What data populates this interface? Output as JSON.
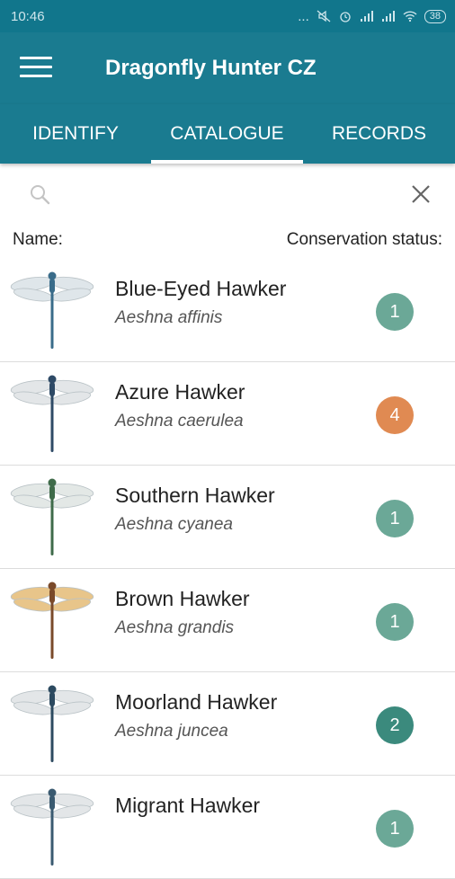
{
  "status_bar": {
    "time": "10:46",
    "dots": "...",
    "battery": "38"
  },
  "app_bar": {
    "title": "Dragonfly Hunter CZ"
  },
  "tabs": [
    {
      "label": "IDENTIFY"
    },
    {
      "label": "CATALOGUE",
      "active": true
    },
    {
      "label": "RECORDS"
    }
  ],
  "search": {
    "placeholder": "",
    "value": ""
  },
  "list_header": {
    "name": "Name:",
    "status": "Conservation status:"
  },
  "species": [
    {
      "common": "Blue-Eyed Hawker",
      "latin": "Aeshna affinis",
      "status": "1",
      "status_color": "#6ba897",
      "wing_color": "#dfe6ea",
      "body_color": "#3a6c8a"
    },
    {
      "common": "Azure Hawker",
      "latin": "Aeshna caerulea",
      "status": "4",
      "status_color": "#e08a52",
      "wing_color": "#e3e6e8",
      "body_color": "#2e4a66"
    },
    {
      "common": "Southern Hawker",
      "latin": "Aeshna cyanea",
      "status": "1",
      "status_color": "#6ba897",
      "wing_color": "#e3e8e6",
      "body_color": "#3f6b4a"
    },
    {
      "common": "Brown Hawker",
      "latin": "Aeshna grandis",
      "status": "1",
      "status_color": "#6ba897",
      "wing_color": "#e8c58a",
      "body_color": "#7a4a2a"
    },
    {
      "common": "Moorland Hawker",
      "latin": "Aeshna juncea",
      "status": "2",
      "status_color": "#3b8a7d",
      "wing_color": "#e3e6e8",
      "body_color": "#2c4a60"
    },
    {
      "common": "Migrant Hawker",
      "latin": "",
      "status": "1",
      "status_color": "#6ba897",
      "wing_color": "#e3e6e8",
      "body_color": "#3a5a70"
    }
  ],
  "colors": {
    "primary": "#1a7b90",
    "status_bar": "#11768c"
  }
}
